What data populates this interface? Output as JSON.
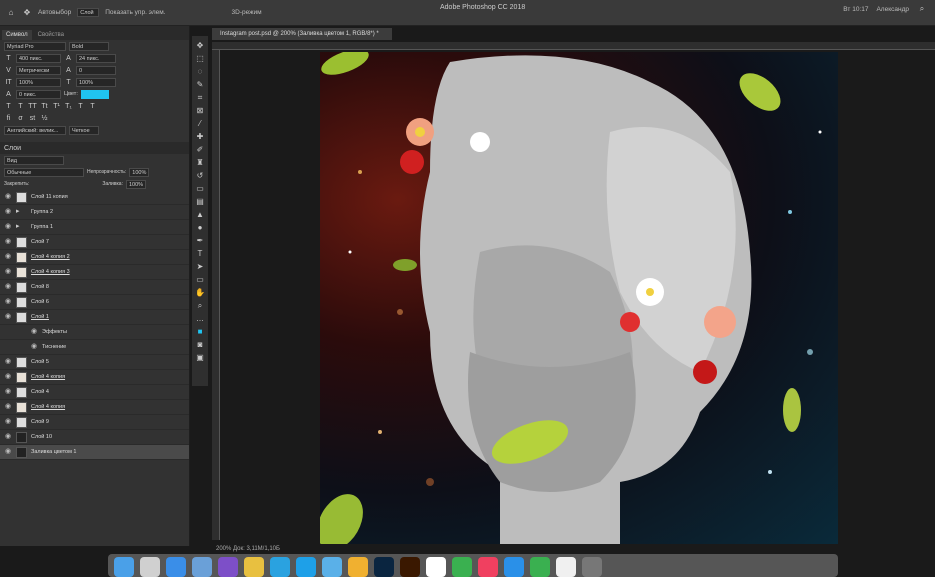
{
  "app_title": "Adobe Photoshop CC 2018",
  "topbar": {
    "autoselect_label": "Автовыбор",
    "autoselect_value": "Слой",
    "transform_label": "Показать упр. элем.",
    "mode3d_label": "3D-режим",
    "clock": "Вт 10:17",
    "user": "Александр"
  },
  "panels": {
    "char_tab": "Символ",
    "props_tab": "Свойства",
    "font_family": "Myriad Pro",
    "font_style": "Bold",
    "font_size": "400 пикс.",
    "leading": "24 пикс.",
    "kerning": "Метрически",
    "tracking": "0",
    "vscale": "100%",
    "hscale": "100%",
    "baseline": "0 пикс.",
    "color_label": "Цвет:",
    "lang": "Английский: велик...",
    "aa": "Четкое",
    "layers_title": "Слои",
    "kind_label": "Вид",
    "blend_mode": "Обычные",
    "opacity_label": "Непрозрачность:",
    "opacity": "100%",
    "lock_label": "Закрепить:",
    "fill_label": "Заливка:",
    "fill": "100%"
  },
  "layers": [
    {
      "name": "Слой 11 копия",
      "thumb": "light",
      "underline": false
    },
    {
      "name": "Группа 2",
      "thumb": "folder",
      "underline": false
    },
    {
      "name": "Группа 1",
      "thumb": "folder",
      "underline": false
    },
    {
      "name": "Слой 7",
      "thumb": "light",
      "underline": false
    },
    {
      "name": "Слой 4 копия 2",
      "thumb": "red",
      "underline": true
    },
    {
      "name": "Слой 4 копия 3",
      "thumb": "red",
      "underline": true
    },
    {
      "name": "Слой 8",
      "thumb": "light",
      "underline": false
    },
    {
      "name": "Слой 6",
      "thumb": "light",
      "underline": false
    },
    {
      "name": "Слой 1",
      "thumb": "light",
      "underline": true
    },
    {
      "name": "Эффекты",
      "thumb": "none",
      "underline": false
    },
    {
      "name": "Тиснение",
      "thumb": "none",
      "underline": false
    },
    {
      "name": "Слой 5",
      "thumb": "light",
      "underline": false
    },
    {
      "name": "Слой 4 копия",
      "thumb": "red",
      "underline": true
    },
    {
      "name": "Слой 4",
      "thumb": "light",
      "underline": false
    },
    {
      "name": "Слой 4 копия",
      "thumb": "red",
      "underline": true
    },
    {
      "name": "Слой 9",
      "thumb": "light",
      "underline": false
    },
    {
      "name": "Слой 10",
      "thumb": "dark",
      "underline": false
    },
    {
      "name": "Заливка цветом 1",
      "thumb": "dark",
      "underline": false
    }
  ],
  "doc_tab": "Instagram post.psd @ 200% (Заливка цветом 1, RGB/8*) *",
  "status": "200%     Док: 3,11М/1,10Б",
  "colors": {
    "accent_swatch": "#20c4f0",
    "panel_bg": "#323232"
  },
  "dock_apps": [
    "finder",
    "launchpad",
    "safari",
    "preview",
    "viber",
    "chrome",
    "telegram",
    "skype",
    "mail",
    "sketch",
    "photoshop",
    "illustrator",
    "calendar",
    "facetime",
    "music",
    "appstore",
    "numbers",
    "notes",
    "trash"
  ]
}
